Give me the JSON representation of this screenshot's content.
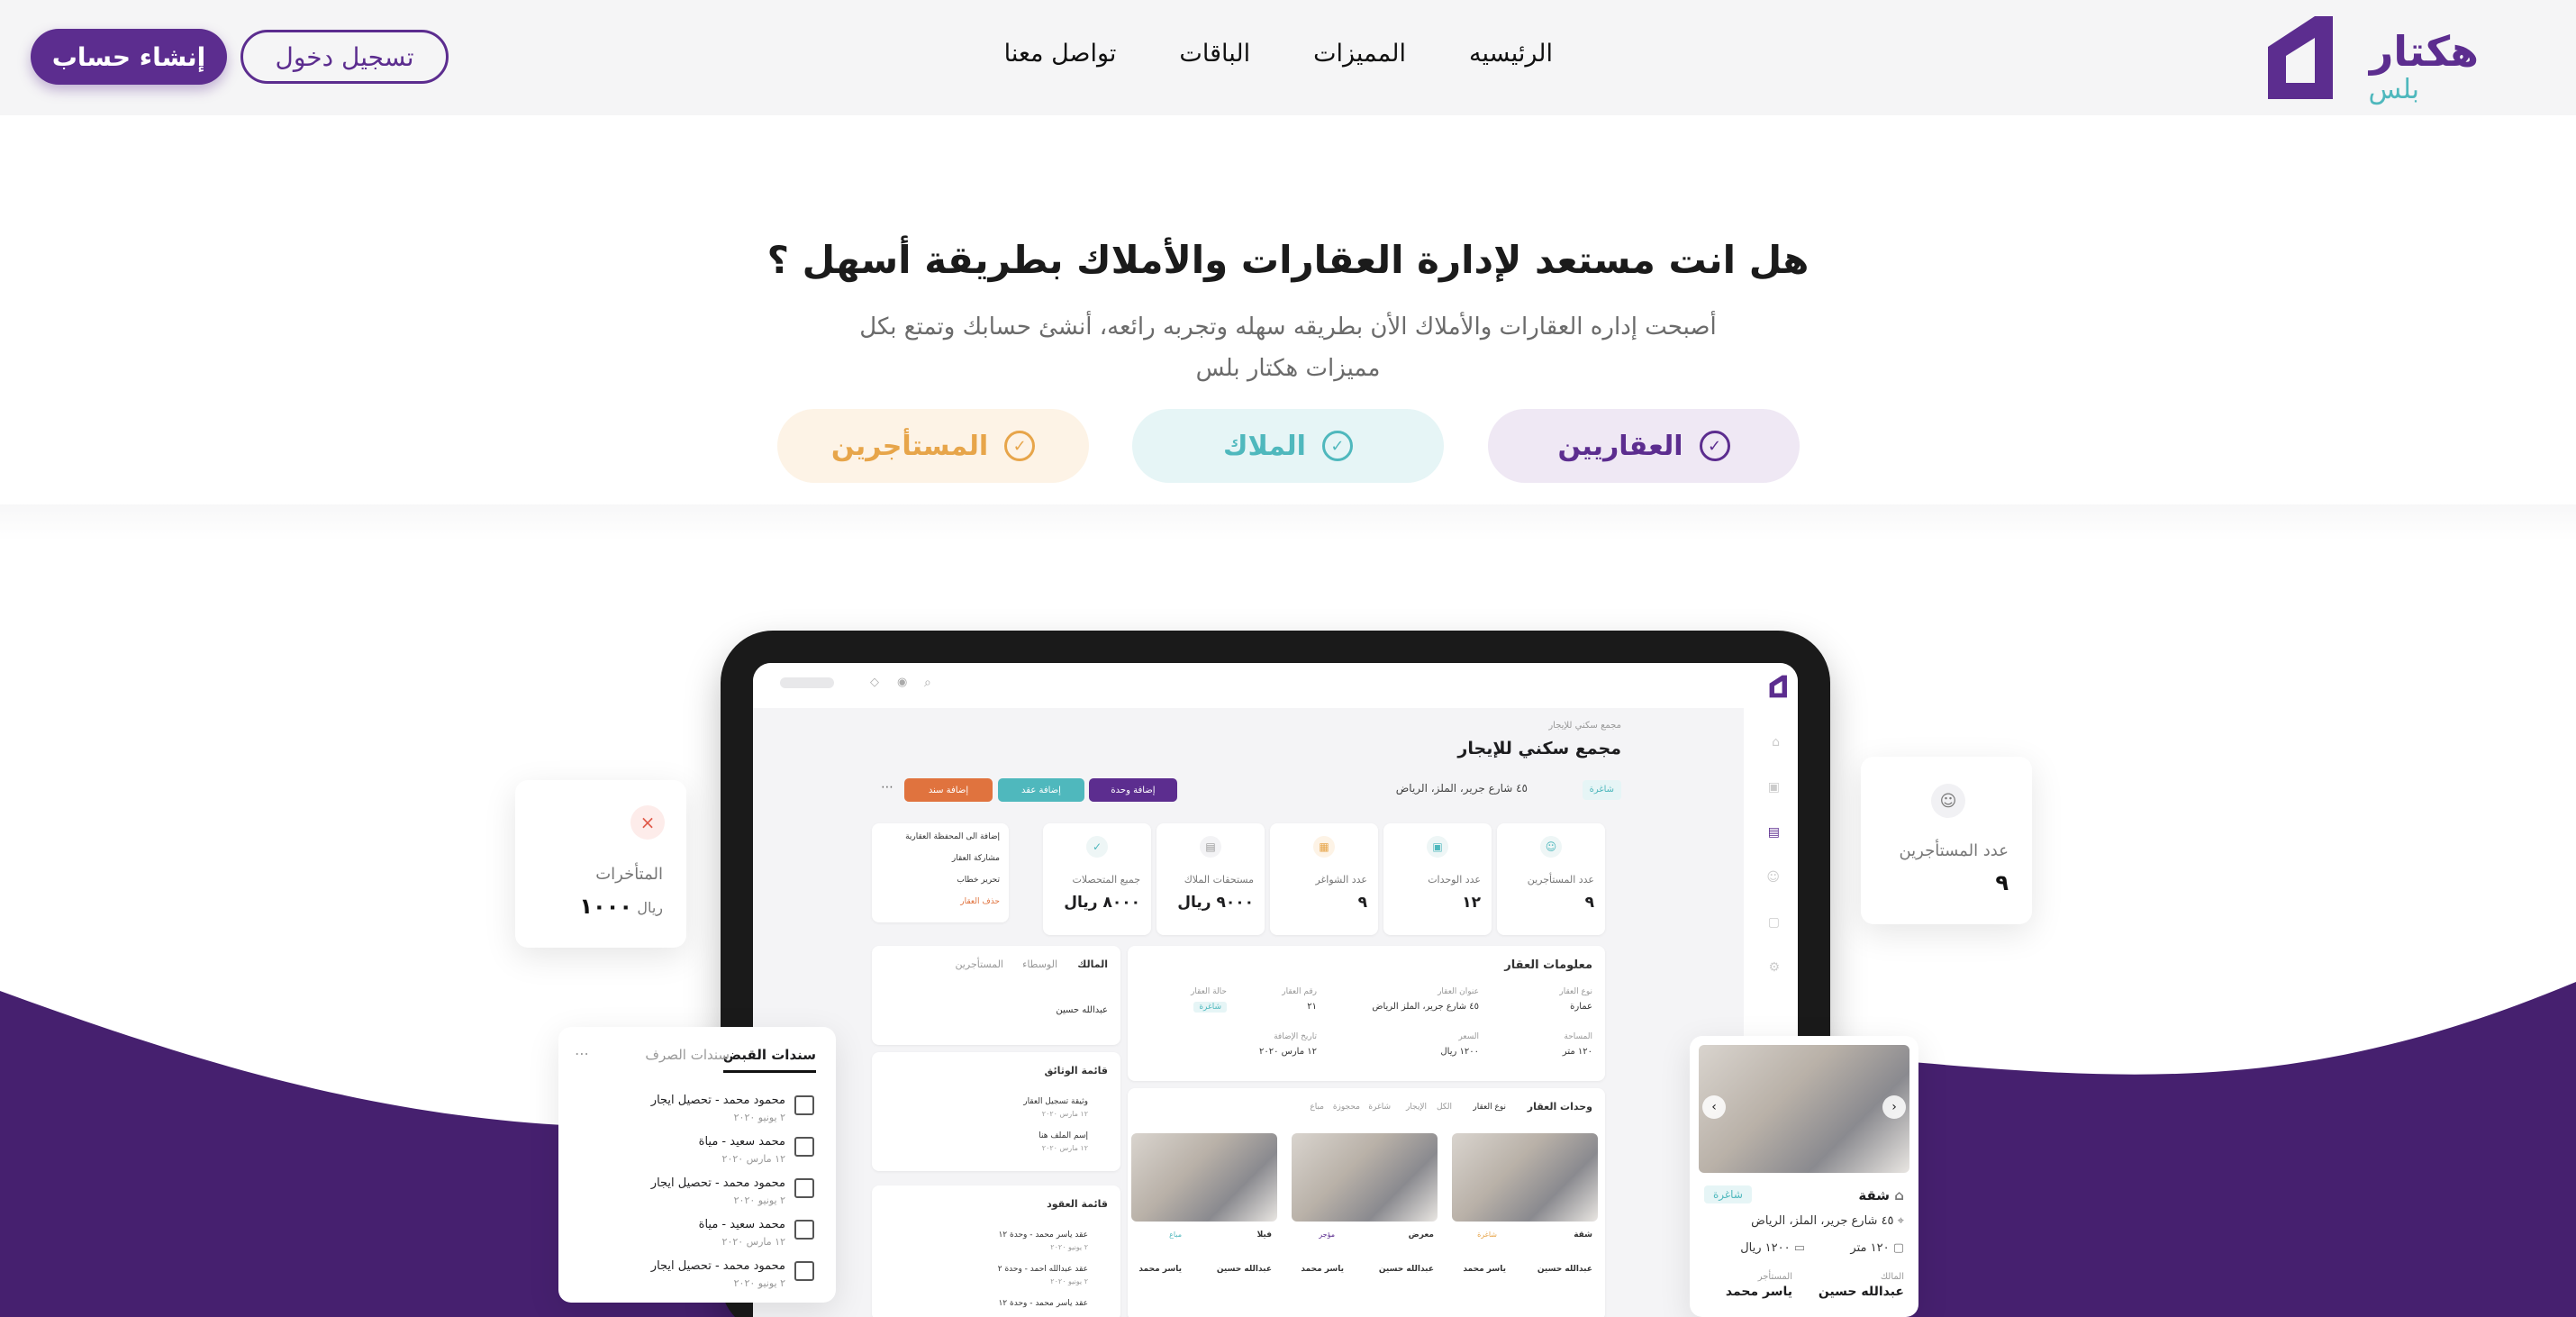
{
  "brand": {
    "name": "هكتار",
    "sub": "بلس"
  },
  "nav": {
    "items": [
      {
        "label": "الرئيسيه"
      },
      {
        "label": "المميزات"
      },
      {
        "label": "الباقات"
      },
      {
        "label": "تواصل معنا"
      }
    ]
  },
  "header": {
    "login_label": "تسجيل دخول",
    "signup_label": "إنشاء حساب"
  },
  "hero": {
    "title": "هل انت مستعد لإدارة العقارات والأملاك بطريقة أسهل ؟",
    "subtitle": "أصبحت إداره العقارات والأملاك الأن بطريقه سهله وتجربه رائعه، أنشئ حسابك وتمتع بكل مميزات هكتار بلس",
    "pills": [
      {
        "label": "العقاريين",
        "color": "#5c2d8f"
      },
      {
        "label": "الملاك",
        "color": "#4fb8bd"
      },
      {
        "label": "المستأجرين",
        "color": "#e7a54a"
      }
    ]
  },
  "colors": {
    "brand": "#5c2d8f",
    "teal": "#4fb8bd",
    "orange": "#e7a54a"
  },
  "float_tenants": {
    "label": "عدد المستأجرين",
    "value": "٩"
  },
  "float_arrears": {
    "label": "المتأخرات",
    "value": "١٠٠٠",
    "unit": "ريال"
  },
  "receipts": {
    "tabs": [
      "سندات القبض",
      "سندات الصرف"
    ],
    "rows": [
      {
        "title": "محمود محمد - تحصيل ايجار",
        "date": "٢ يونيو ٢٠٢٠"
      },
      {
        "title": "محمد سعيد - مياة",
        "date": "١٢ مارس ٢٠٢٠"
      },
      {
        "title": "محمود محمد - تحصيل ايجار",
        "date": "٢ يونيو ٢٠٢٠"
      },
      {
        "title": "محمد سعيد - مياة",
        "date": "١٢ مارس ٢٠٢٠"
      },
      {
        "title": "محمود محمد - تحصيل ايجار",
        "date": "٢ يونيو ٢٠٢٠"
      }
    ]
  },
  "unit_card": {
    "type": "شقة",
    "status": "شاغرة",
    "address": "٤٥ شارع جرير، الملز، الرياض",
    "area": "١٢٠ متر",
    "price": "١٢٠٠ ريال",
    "owner_label": "المالك",
    "owner": "عبدالله حسين",
    "tenant_label": "المستأجر",
    "tenant": "ياسر محمد"
  },
  "screen": {
    "crumb": "مجمع سكني للإيجار",
    "title": "مجمع سكني للإيجار",
    "address": "٤٥ شارع جرير، الملز، الرياض",
    "badge": "شاغرة",
    "buttons": [
      {
        "label": "إضافة وحدة",
        "color": "#5c2d8f"
      },
      {
        "label": "إضافة عقد",
        "color": "#4fb8bd"
      },
      {
        "label": "إضافة سند",
        "color": "#e0733e"
      }
    ],
    "stats": [
      {
        "label": "عدد المستأجرين",
        "value": "٩"
      },
      {
        "label": "عدد الوحدات",
        "value": "١٢"
      },
      {
        "label": "عدد الشواغر",
        "value": "٩"
      },
      {
        "label": "مستحقات الملاك",
        "value": "٩٠٠٠ ريال"
      },
      {
        "label": "جميع المتحصلات",
        "value": "٨٠٠٠ ريال"
      }
    ],
    "menu": [
      "إضافة الى المحفظة العقارية",
      "مشاركة العقار",
      "تحرير خطاب",
      "حذف العقار"
    ],
    "info_title": "معلومات العقار",
    "info": [
      {
        "label": "نوع العقار",
        "value": "عمارة"
      },
      {
        "label": "عنوان العقار",
        "value": "٤٥ شارع جرير، الملز الرياض"
      },
      {
        "label": "رقم العقار",
        "value": "٢١"
      },
      {
        "label": "حالة العقار",
        "value": "شاغرة"
      },
      {
        "label": "المساحة",
        "value": "١٢٠ متر"
      },
      {
        "label": "السعر",
        "value": "١٢٠٠ ريال"
      },
      {
        "label": "تاريخ الإضافة",
        "value": "١٢ مارس ٢٠٢٠"
      }
    ],
    "tabs": [
      "المالك",
      "الوسطاء",
      "المستأجرين"
    ],
    "owner_name": "عبدالله حسين",
    "docs_title": "قائمة الوثائق",
    "docs": [
      {
        "title": "وثيقة تسجيل العقار",
        "date": "١٢ مارس ٢٠٢٠"
      },
      {
        "title": "إسم الملف هنا",
        "date": "١٢ مارس ٢٠٢٠"
      }
    ],
    "contracts_title": "قائمة العقود",
    "contracts": [
      {
        "title": "عقد ياسر محمد - وحدة ١٢",
        "date": "٢ يونيو ٢٠٢٠"
      },
      {
        "title": "عقد عبدالله احمد - وحدة ٢",
        "date": "٢ يونيو ٢٠٢٠"
      },
      {
        "title": "عقد ياسر محمد - وحدة ١٢",
        "date": ""
      }
    ],
    "units_title": "وحدات العقار",
    "units_filters": [
      "نوع العقار",
      "الكل",
      "الإيجار",
      "شاغرة",
      "محجوزة",
      "مباع"
    ],
    "units": [
      {
        "type": "شقة",
        "status": "شاغرة",
        "owner": "عبدالله حسين",
        "tenant": "ياسر محمد"
      },
      {
        "type": "معرض",
        "status": "مؤجر",
        "owner": "عبدالله حسين",
        "tenant": "ياسر محمد"
      },
      {
        "type": "فيلا",
        "status": "مباع",
        "owner": "عبدالله حسين",
        "tenant": "ياسر محمد"
      }
    ]
  }
}
